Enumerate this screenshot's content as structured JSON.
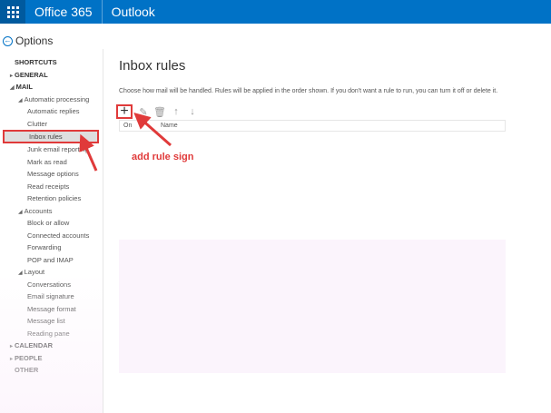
{
  "topbar": {
    "brand": "Office 365",
    "app": "Outlook"
  },
  "options_title": "Options",
  "nav": {
    "items": [
      {
        "label": "SHORTCUTS"
      },
      {
        "label": "GENERAL"
      },
      {
        "label": "MAIL"
      },
      {
        "label": "Automatic processing"
      },
      {
        "label": "Automatic replies"
      },
      {
        "label": "Clutter"
      },
      {
        "label": "Inbox rules"
      },
      {
        "label": "Junk email reporting"
      },
      {
        "label": "Mark as read"
      },
      {
        "label": "Message options"
      },
      {
        "label": "Read receipts"
      },
      {
        "label": "Retention policies"
      },
      {
        "label": "Accounts"
      },
      {
        "label": "Block or allow"
      },
      {
        "label": "Connected accounts"
      },
      {
        "label": "Forwarding"
      },
      {
        "label": "POP and IMAP"
      },
      {
        "label": "Layout"
      },
      {
        "label": "Conversations"
      },
      {
        "label": "Email signature"
      },
      {
        "label": "Message format"
      },
      {
        "label": "Message list"
      },
      {
        "label": "Reading pane"
      },
      {
        "label": "CALENDAR"
      },
      {
        "label": "PEOPLE"
      },
      {
        "label": "OTHER"
      }
    ]
  },
  "main": {
    "title": "Inbox rules",
    "description": "Choose how mail will be handled. Rules will be applied in the order shown. If you don't want a rule to run, you can turn it off or delete it.",
    "toolbar": {
      "add": "+",
      "edit": "✎",
      "delete": "🗑",
      "up": "↑",
      "down": "↓"
    },
    "table": {
      "col_on": "On",
      "col_name": "Name"
    }
  },
  "annotation": {
    "label": "add rule sign",
    "color": "#e03a3a"
  },
  "colors": {
    "accent": "#0072c6",
    "accent_dark": "#005a9e",
    "highlight": "#e03a3a"
  }
}
